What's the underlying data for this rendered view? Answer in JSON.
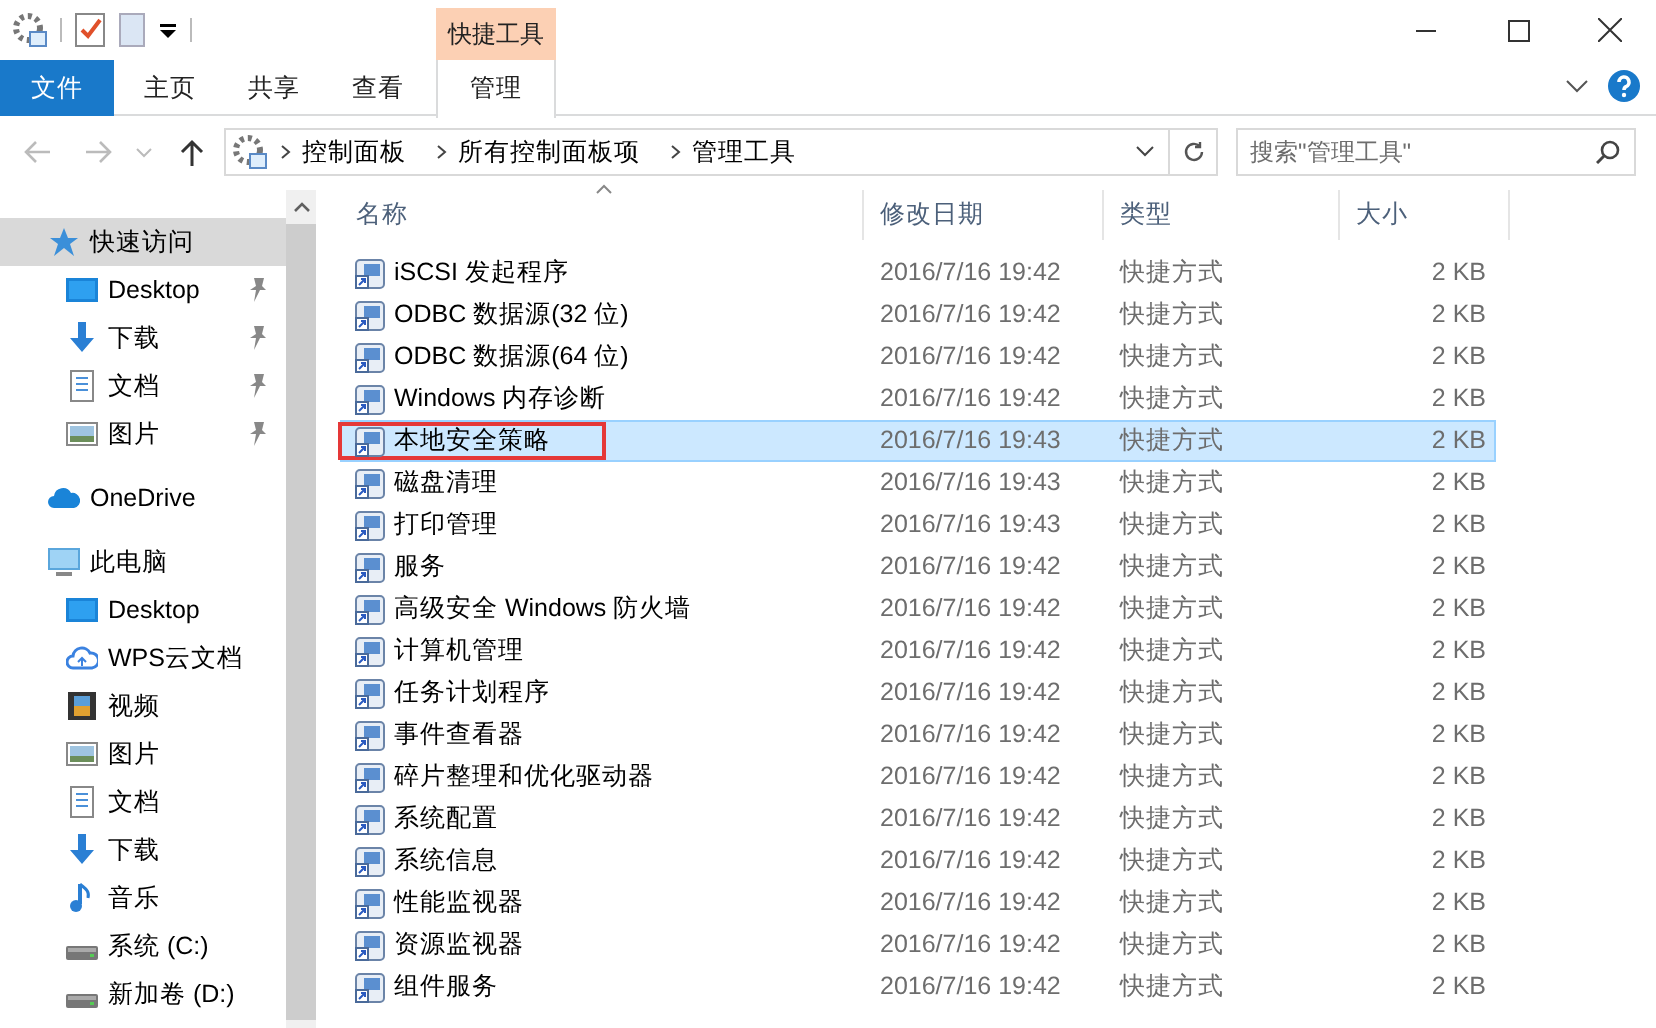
{
  "window": {
    "context_tab_group": "快捷工具"
  },
  "ribbon_tabs": [
    {
      "label": "文件",
      "kind": "file",
      "selected": false
    },
    {
      "label": "主页",
      "kind": "tab",
      "selected": false
    },
    {
      "label": "共享",
      "kind": "tab",
      "selected": false
    },
    {
      "label": "查看",
      "kind": "tab",
      "selected": false
    },
    {
      "label": "管理",
      "kind": "context",
      "selected": true
    }
  ],
  "address": {
    "crumbs": [
      "控制面板",
      "所有控制面板项",
      "管理工具"
    ]
  },
  "search": {
    "placeholder": "搜索\"管理工具\""
  },
  "sidebar": {
    "items": [
      {
        "label": "快速访问",
        "kind": "star",
        "selected": true,
        "children": [
          {
            "label": "Desktop",
            "kind": "desktop",
            "pinned": true,
            "selected": false
          },
          {
            "label": "下载",
            "kind": "download",
            "pinned": true,
            "selected": false
          },
          {
            "label": "文档",
            "kind": "document",
            "pinned": true,
            "selected": false
          },
          {
            "label": "图片",
            "kind": "picture",
            "pinned": true,
            "selected": false
          }
        ]
      },
      {
        "label": "OneDrive",
        "kind": "onedrive",
        "selected": false
      },
      {
        "label": "此电脑",
        "kind": "computer",
        "selected": false,
        "children": [
          {
            "label": "Desktop",
            "kind": "desktop",
            "pinned": false,
            "selected": false
          },
          {
            "label": "WPS云文档",
            "kind": "cloud",
            "pinned": false,
            "selected": false
          },
          {
            "label": "视频",
            "kind": "video",
            "pinned": false,
            "selected": false
          },
          {
            "label": "图片",
            "kind": "picture",
            "pinned": false,
            "selected": false
          },
          {
            "label": "文档",
            "kind": "document",
            "pinned": false,
            "selected": false
          },
          {
            "label": "下载",
            "kind": "download",
            "pinned": false,
            "selected": false
          },
          {
            "label": "音乐",
            "kind": "music",
            "pinned": false,
            "selected": false
          },
          {
            "label": "系统 (C:)",
            "kind": "drive",
            "pinned": false,
            "selected": false
          },
          {
            "label": "新加卷 (D:)",
            "kind": "drive",
            "pinned": false,
            "selected": false
          }
        ]
      }
    ]
  },
  "table": {
    "columns": [
      "名称",
      "修改日期",
      "类型",
      "大小"
    ],
    "rows": [
      {
        "name": "iSCSI 发起程序",
        "date": "2016/7/16 19:42",
        "type": "快捷方式",
        "size": "2 KB",
        "selected": false,
        "annotated": false
      },
      {
        "name": "ODBC 数据源(32 位)",
        "date": "2016/7/16 19:42",
        "type": "快捷方式",
        "size": "2 KB",
        "selected": false,
        "annotated": false
      },
      {
        "name": "ODBC 数据源(64 位)",
        "date": "2016/7/16 19:42",
        "type": "快捷方式",
        "size": "2 KB",
        "selected": false,
        "annotated": false
      },
      {
        "name": "Windows 内存诊断",
        "date": "2016/7/16 19:42",
        "type": "快捷方式",
        "size": "2 KB",
        "selected": false,
        "annotated": false
      },
      {
        "name": "本地安全策略",
        "date": "2016/7/16 19:43",
        "type": "快捷方式",
        "size": "2 KB",
        "selected": true,
        "annotated": true
      },
      {
        "name": "磁盘清理",
        "date": "2016/7/16 19:43",
        "type": "快捷方式",
        "size": "2 KB",
        "selected": false,
        "annotated": false
      },
      {
        "name": "打印管理",
        "date": "2016/7/16 19:43",
        "type": "快捷方式",
        "size": "2 KB",
        "selected": false,
        "annotated": false
      },
      {
        "name": "服务",
        "date": "2016/7/16 19:42",
        "type": "快捷方式",
        "size": "2 KB",
        "selected": false,
        "annotated": false
      },
      {
        "name": "高级安全 Windows 防火墙",
        "date": "2016/7/16 19:42",
        "type": "快捷方式",
        "size": "2 KB",
        "selected": false,
        "annotated": false
      },
      {
        "name": "计算机管理",
        "date": "2016/7/16 19:42",
        "type": "快捷方式",
        "size": "2 KB",
        "selected": false,
        "annotated": false
      },
      {
        "name": "任务计划程序",
        "date": "2016/7/16 19:42",
        "type": "快捷方式",
        "size": "2 KB",
        "selected": false,
        "annotated": false
      },
      {
        "name": "事件查看器",
        "date": "2016/7/16 19:42",
        "type": "快捷方式",
        "size": "2 KB",
        "selected": false,
        "annotated": false
      },
      {
        "name": "碎片整理和优化驱动器",
        "date": "2016/7/16 19:42",
        "type": "快捷方式",
        "size": "2 KB",
        "selected": false,
        "annotated": false
      },
      {
        "name": "系统配置",
        "date": "2016/7/16 19:42",
        "type": "快捷方式",
        "size": "2 KB",
        "selected": false,
        "annotated": false
      },
      {
        "name": "系统信息",
        "date": "2016/7/16 19:42",
        "type": "快捷方式",
        "size": "2 KB",
        "selected": false,
        "annotated": false
      },
      {
        "name": "性能监视器",
        "date": "2016/7/16 19:42",
        "type": "快捷方式",
        "size": "2 KB",
        "selected": false,
        "annotated": false
      },
      {
        "name": "资源监视器",
        "date": "2016/7/16 19:42",
        "type": "快捷方式",
        "size": "2 KB",
        "selected": false,
        "annotated": false
      },
      {
        "name": "组件服务",
        "date": "2016/7/16 19:42",
        "type": "快捷方式",
        "size": "2 KB",
        "selected": false,
        "annotated": false
      }
    ]
  }
}
